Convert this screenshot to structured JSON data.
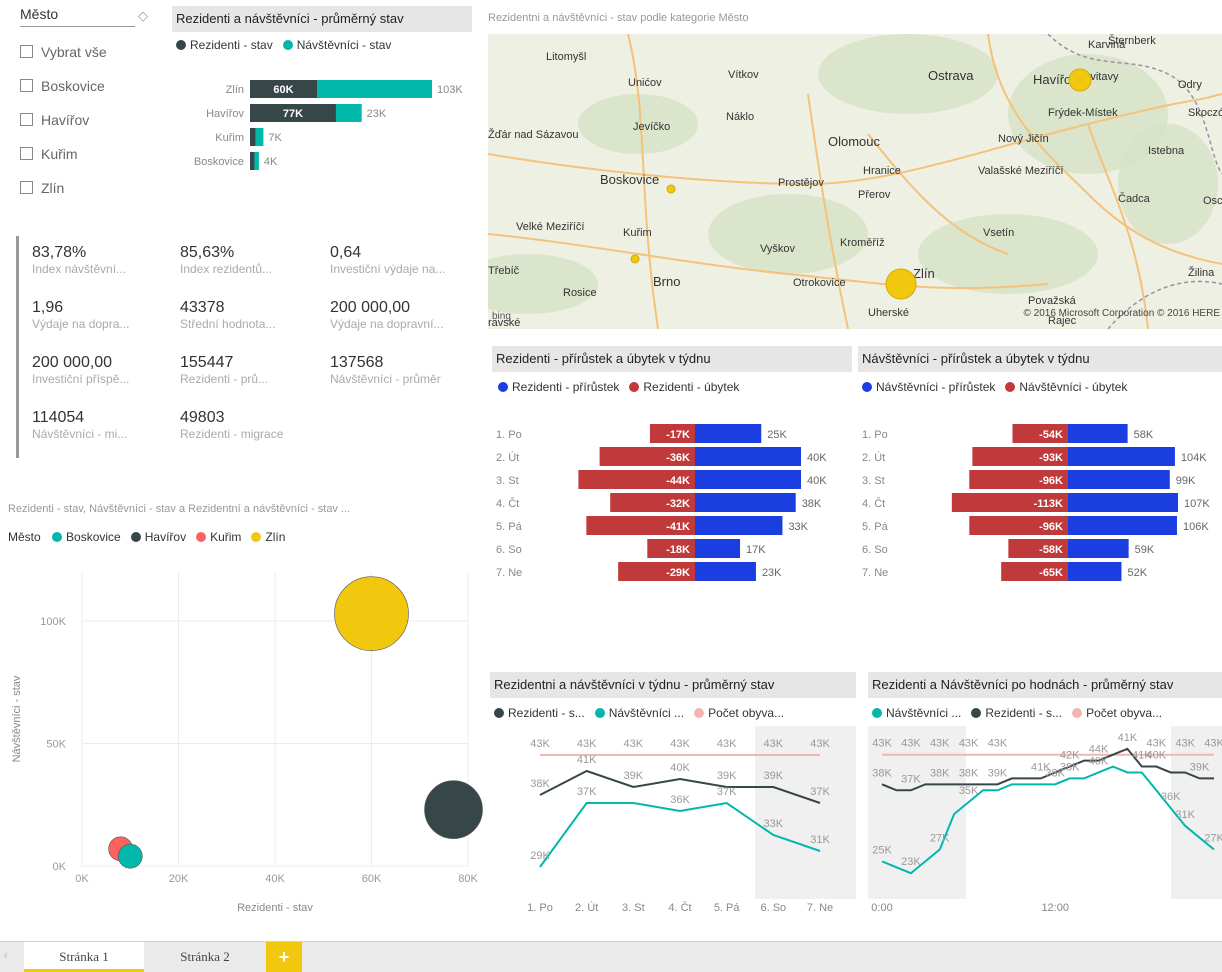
{
  "slicer": {
    "title": "Město",
    "items": [
      "Vybrat vše",
      "Boskovice",
      "Havířov",
      "Kuřim",
      "Zlín"
    ]
  },
  "avg_state": {
    "title": "Rezidenti a návštěvníci - průměrný stav",
    "legend": [
      {
        "name": "Rezidenti - stav",
        "color": "#374649"
      },
      {
        "name": "Návštěvníci - stav",
        "color": "#01b8aa"
      }
    ],
    "chart_data": {
      "type": "bar",
      "orientation": "horizontal-stacked",
      "categories": [
        "Zlín",
        "Havířov",
        "Kuřim",
        "Boskovice"
      ],
      "series": [
        {
          "name": "Rezidenti - stav",
          "values": [
            60000,
            77000,
            5000,
            4000
          ],
          "labels": [
            "60K",
            "77K",
            "",
            ""
          ]
        },
        {
          "name": "Návštěvníci - stav",
          "values": [
            103000,
            23000,
            7000,
            4000
          ],
          "labels": [
            "103K",
            "23K",
            "7K",
            "4K"
          ]
        }
      ]
    }
  },
  "map": {
    "title": "Rezidentni a návštěvníci - stav podle kategorie Město",
    "copyright": "© 2016 Microsoft Corporation   © 2016 HERE",
    "bing": "bing",
    "towns": [
      "Litomyšl",
      "Unićov",
      "Vítkov",
      "Ostrava",
      "Havířov",
      "Karviná",
      "Svitavy",
      "Šternberk",
      "Odry",
      "Frýdek-Místek",
      "Skoczów",
      "Jevíčko",
      "Náklo",
      "Olomouc",
      "Nový Jičín",
      "Istebna",
      "Žďár nad Sázavou",
      "Boskovice",
      "Prostějov",
      "Hranice",
      "Valašské Meziříčí",
      "Přerov",
      "Čadca",
      "Osca",
      "Velké Meziříčí",
      "Kuřim",
      "Vsetín",
      "Vyškov",
      "Kroměříž",
      "Zlín",
      "Žilina",
      "Třebíč",
      "Brno",
      "Otrokovice",
      "Rosice",
      "Uherské",
      "Považská",
      "Rajec",
      "ravské"
    ]
  },
  "cards": [
    {
      "value": "83,78%",
      "label": "Index návštěvní..."
    },
    {
      "value": "85,63%",
      "label": "Index rezidentů..."
    },
    {
      "value": "0,64",
      "label": "Investiční výdaje na..."
    },
    {
      "value": "1,96",
      "label": "Výdaje na dopra..."
    },
    {
      "value": "43378",
      "label": "Střední hodnota..."
    },
    {
      "value": "200 000,00",
      "label": "Výdaje na dopravní..."
    },
    {
      "value": "200 000,00",
      "label": "Investiční příspě..."
    },
    {
      "value": "155447",
      "label": "Rezidenti - prů..."
    },
    {
      "value": "137568",
      "label": "Návštěvníci - průměr"
    },
    {
      "value": "114054",
      "label": "Návštěvníci - mi..."
    },
    {
      "value": "49803",
      "label": "Rezidenti - migrace"
    }
  ],
  "res_week": {
    "title": "Rezidenti - přírůstek a úbytek v týdnu",
    "legend": [
      {
        "name": "Rezidenti - přírůstek",
        "color": "#1a3ee0"
      },
      {
        "name": "Rezidenti - úbytek",
        "color": "#c0393b"
      }
    ],
    "chart_data": {
      "type": "bar",
      "orientation": "horizontal-diverging",
      "categories": [
        "1. Po",
        "2. Út",
        "3. St",
        "4. Čt",
        "5. Pá",
        "6. So",
        "7. Ne"
      ],
      "series": [
        {
          "name": "Rezidenti - přírůstek",
          "values": [
            25000,
            40000,
            40000,
            38000,
            33000,
            17000,
            23000
          ],
          "labels": [
            "25K",
            "40K",
            "40K",
            "38K",
            "33K",
            "17K",
            "23K"
          ]
        },
        {
          "name": "Rezidenti - úbytek",
          "values": [
            -17000,
            -36000,
            -44000,
            -32000,
            -41000,
            -18000,
            -29000
          ],
          "labels": [
            "-17K",
            "-36K",
            "-44K",
            "-32K",
            "-41K",
            "-18K",
            "-29K"
          ]
        }
      ]
    }
  },
  "vis_week": {
    "title": "Návštěvníci - přírůstek a úbytek v týdnu",
    "legend": [
      {
        "name": "Návštěvníci - přírůstek",
        "color": "#1a3ee0"
      },
      {
        "name": "Návštěvníci - úbytek",
        "color": "#c0393b"
      }
    ],
    "chart_data": {
      "type": "bar",
      "orientation": "horizontal-diverging",
      "categories": [
        "1. Po",
        "2. Út",
        "3. St",
        "4. Čt",
        "5. Pá",
        "6. So",
        "7. Ne"
      ],
      "series": [
        {
          "name": "Návštěvníci - přírůstek",
          "values": [
            58000,
            104000,
            99000,
            107000,
            106000,
            59000,
            52000
          ],
          "labels": [
            "58K",
            "104K",
            "99K",
            "107K",
            "106K",
            "59K",
            "52K"
          ]
        },
        {
          "name": "Návštěvníci - úbytek",
          "values": [
            -54000,
            -93000,
            -96000,
            -113000,
            -96000,
            -58000,
            -65000
          ],
          "labels": [
            "-54K",
            "-93K",
            "-96K",
            "-113K",
            "-96K",
            "-58K",
            "-65K"
          ]
        }
      ]
    }
  },
  "scatter": {
    "title": "Rezidenti - stav, Návštěvníci - stav a Rezidentní a návštěvníci - stav ...",
    "legend_title": "Město",
    "legend": [
      {
        "name": "Boskovice",
        "color": "#01b8aa"
      },
      {
        "name": "Havířov",
        "color": "#374649"
      },
      {
        "name": "Kuřim",
        "color": "#fd625e"
      },
      {
        "name": "Zlín",
        "color": "#f2c80f"
      }
    ],
    "chart_data": {
      "type": "scatter",
      "xlabel": "Rezidenti - stav",
      "ylabel": "Návštěvníci - stav",
      "xlim": [
        0,
        80000
      ],
      "ylim": [
        0,
        120000
      ],
      "xticks": [
        "0K",
        "20K",
        "40K",
        "60K",
        "80K"
      ],
      "yticks": [
        "0K",
        "50K",
        "100K"
      ],
      "ytick_values": [
        0,
        50000,
        100000
      ],
      "points": [
        {
          "city": "Kuřim",
          "x": 8000,
          "y": 7000,
          "size": 12000,
          "color": "#fd625e"
        },
        {
          "city": "Boskovice",
          "x": 10000,
          "y": 4000,
          "size": 8000,
          "color": "#01b8aa"
        },
        {
          "city": "Zlín",
          "x": 60000,
          "y": 103000,
          "size": 163000,
          "color": "#f2c80f"
        },
        {
          "city": "Havířov",
          "x": 77000,
          "y": 23000,
          "size": 100000,
          "color": "#374649"
        }
      ]
    }
  },
  "week_line": {
    "title": "Rezidentni a návštěvníci v týdnu - průměrný stav",
    "legend": [
      {
        "name": "Rezidenti - s...",
        "color": "#374649"
      },
      {
        "name": "Návštěvníci ...",
        "color": "#01b8aa"
      },
      {
        "name": "Počet obyva...",
        "color": "#f4b4b4"
      }
    ],
    "chart_data": {
      "type": "line",
      "categories": [
        "1. Po",
        "2. Út",
        "3. St",
        "4. Čt",
        "5. Pá",
        "6. So",
        "7. Ne"
      ],
      "ylim": [
        26000,
        46000
      ],
      "series": [
        {
          "name": "Rezidenti - s...",
          "values": [
            38000,
            41000,
            39000,
            40000,
            39000,
            39000,
            37000
          ],
          "labels": [
            "38K",
            "41K",
            "39K",
            "40K",
            "39K",
            "39K",
            "37K"
          ]
        },
        {
          "name": "Návštěvníci ...",
          "values": [
            29000,
            37000,
            37000,
            36000,
            37000,
            33000,
            31000
          ],
          "labels": [
            "29K",
            "37K",
            "",
            "36K",
            "37K",
            "33K",
            "31K"
          ]
        },
        {
          "name": "Počet obyva...",
          "values": [
            43000,
            43000,
            43000,
            43000,
            43000,
            43000,
            43000
          ],
          "labels": [
            "43K",
            "43K",
            "43K",
            "43K",
            "43K",
            "43K",
            "43K"
          ]
        }
      ]
    }
  },
  "hour_line": {
    "title": "Rezidenti a Návštěvníci po hodnách - průměrný stav",
    "legend": [
      {
        "name": "Návštěvníci ...",
        "color": "#01b8aa"
      },
      {
        "name": "Rezidenti - s...",
        "color": "#374649"
      },
      {
        "name": "Počet obyva...",
        "color": "#f4b4b4"
      }
    ],
    "chart_data": {
      "type": "line",
      "x_ticks": [
        "0:00",
        "12:00"
      ],
      "ylim": [
        20000,
        47000
      ],
      "series": [
        {
          "name": "Návštěvníci ...",
          "values": [
            25000,
            24000,
            23000,
            25000,
            27000,
            33000,
            35000,
            37000,
            37000,
            38000,
            38000,
            38000,
            38000,
            39000,
            39000,
            40000,
            41000,
            40000,
            40000,
            37000,
            34000,
            31000,
            29000,
            27000
          ],
          "labels": [
            "25K",
            "",
            "23K",
            "",
            "27K",
            "",
            "35K",
            "",
            "",
            "",
            "",
            "",
            "38K",
            "38K",
            "",
            "40K",
            "",
            "",
            "",
            "",
            "36K",
            "31K",
            "",
            "27K"
          ]
        },
        {
          "name": "Rezidenti - s...",
          "values": [
            38000,
            37000,
            37000,
            38000,
            38000,
            38000,
            38000,
            38000,
            38000,
            39000,
            39000,
            39000,
            40000,
            41000,
            42000,
            42000,
            43000,
            44000,
            41000,
            41000,
            40000,
            40000,
            39000,
            39000
          ],
          "labels": [
            "38K",
            "",
            "37K",
            "",
            "38K",
            "",
            "38K",
            "",
            "39K",
            "",
            "",
            "41K",
            "",
            "42K",
            "",
            "44K",
            "",
            "41K",
            "41K",
            "40K",
            "",
            "",
            "39K",
            ""
          ]
        },
        {
          "name": "Počet obyva...",
          "values": [
            43000,
            43000,
            43000,
            43000,
            43000,
            43000,
            43000,
            43000,
            43000,
            43000,
            43000,
            43000,
            43000,
            43000,
            43000,
            43000,
            43000,
            43000,
            43000,
            43000,
            43000,
            43000,
            43000,
            43000
          ],
          "labels": [
            "43K",
            "",
            "43K",
            "",
            "43K",
            "",
            "43K",
            "",
            "43K",
            "",
            "",
            "",
            "",
            "",
            "",
            "",
            "",
            "",
            "",
            "43K",
            "",
            "43K",
            "",
            "43K"
          ]
        }
      ]
    }
  },
  "tabs": [
    "Stránka 1",
    "Stránka 2"
  ],
  "add_tab": "+"
}
